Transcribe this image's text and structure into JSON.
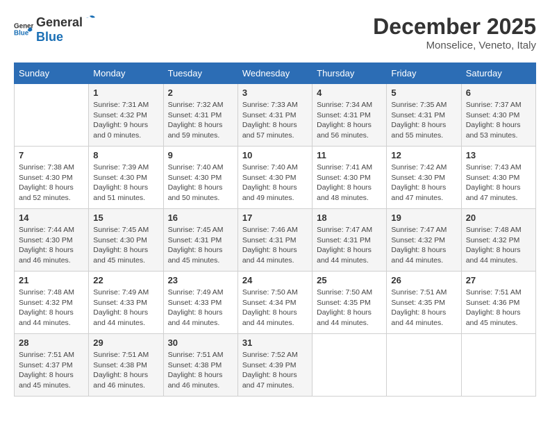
{
  "header": {
    "logo_general": "General",
    "logo_blue": "Blue",
    "month": "December 2025",
    "location": "Monselice, Veneto, Italy"
  },
  "weekdays": [
    "Sunday",
    "Monday",
    "Tuesday",
    "Wednesday",
    "Thursday",
    "Friday",
    "Saturday"
  ],
  "rows": [
    [
      {
        "day": "",
        "sunrise": "",
        "sunset": "",
        "daylight": ""
      },
      {
        "day": "1",
        "sunrise": "7:31 AM",
        "sunset": "4:32 PM",
        "daylight": "9 hours and 0 minutes."
      },
      {
        "day": "2",
        "sunrise": "7:32 AM",
        "sunset": "4:31 PM",
        "daylight": "8 hours and 59 minutes."
      },
      {
        "day": "3",
        "sunrise": "7:33 AM",
        "sunset": "4:31 PM",
        "daylight": "8 hours and 57 minutes."
      },
      {
        "day": "4",
        "sunrise": "7:34 AM",
        "sunset": "4:31 PM",
        "daylight": "8 hours and 56 minutes."
      },
      {
        "day": "5",
        "sunrise": "7:35 AM",
        "sunset": "4:31 PM",
        "daylight": "8 hours and 55 minutes."
      },
      {
        "day": "6",
        "sunrise": "7:37 AM",
        "sunset": "4:30 PM",
        "daylight": "8 hours and 53 minutes."
      }
    ],
    [
      {
        "day": "7",
        "sunrise": "7:38 AM",
        "sunset": "4:30 PM",
        "daylight": "8 hours and 52 minutes."
      },
      {
        "day": "8",
        "sunrise": "7:39 AM",
        "sunset": "4:30 PM",
        "daylight": "8 hours and 51 minutes."
      },
      {
        "day": "9",
        "sunrise": "7:40 AM",
        "sunset": "4:30 PM",
        "daylight": "8 hours and 50 minutes."
      },
      {
        "day": "10",
        "sunrise": "7:40 AM",
        "sunset": "4:30 PM",
        "daylight": "8 hours and 49 minutes."
      },
      {
        "day": "11",
        "sunrise": "7:41 AM",
        "sunset": "4:30 PM",
        "daylight": "8 hours and 48 minutes."
      },
      {
        "day": "12",
        "sunrise": "7:42 AM",
        "sunset": "4:30 PM",
        "daylight": "8 hours and 47 minutes."
      },
      {
        "day": "13",
        "sunrise": "7:43 AM",
        "sunset": "4:30 PM",
        "daylight": "8 hours and 47 minutes."
      }
    ],
    [
      {
        "day": "14",
        "sunrise": "7:44 AM",
        "sunset": "4:30 PM",
        "daylight": "8 hours and 46 minutes."
      },
      {
        "day": "15",
        "sunrise": "7:45 AM",
        "sunset": "4:30 PM",
        "daylight": "8 hours and 45 minutes."
      },
      {
        "day": "16",
        "sunrise": "7:45 AM",
        "sunset": "4:31 PM",
        "daylight": "8 hours and 45 minutes."
      },
      {
        "day": "17",
        "sunrise": "7:46 AM",
        "sunset": "4:31 PM",
        "daylight": "8 hours and 44 minutes."
      },
      {
        "day": "18",
        "sunrise": "7:47 AM",
        "sunset": "4:31 PM",
        "daylight": "8 hours and 44 minutes."
      },
      {
        "day": "19",
        "sunrise": "7:47 AM",
        "sunset": "4:32 PM",
        "daylight": "8 hours and 44 minutes."
      },
      {
        "day": "20",
        "sunrise": "7:48 AM",
        "sunset": "4:32 PM",
        "daylight": "8 hours and 44 minutes."
      }
    ],
    [
      {
        "day": "21",
        "sunrise": "7:48 AM",
        "sunset": "4:32 PM",
        "daylight": "8 hours and 44 minutes."
      },
      {
        "day": "22",
        "sunrise": "7:49 AM",
        "sunset": "4:33 PM",
        "daylight": "8 hours and 44 minutes."
      },
      {
        "day": "23",
        "sunrise": "7:49 AM",
        "sunset": "4:33 PM",
        "daylight": "8 hours and 44 minutes."
      },
      {
        "day": "24",
        "sunrise": "7:50 AM",
        "sunset": "4:34 PM",
        "daylight": "8 hours and 44 minutes."
      },
      {
        "day": "25",
        "sunrise": "7:50 AM",
        "sunset": "4:35 PM",
        "daylight": "8 hours and 44 minutes."
      },
      {
        "day": "26",
        "sunrise": "7:51 AM",
        "sunset": "4:35 PM",
        "daylight": "8 hours and 44 minutes."
      },
      {
        "day": "27",
        "sunrise": "7:51 AM",
        "sunset": "4:36 PM",
        "daylight": "8 hours and 45 minutes."
      }
    ],
    [
      {
        "day": "28",
        "sunrise": "7:51 AM",
        "sunset": "4:37 PM",
        "daylight": "8 hours and 45 minutes."
      },
      {
        "day": "29",
        "sunrise": "7:51 AM",
        "sunset": "4:38 PM",
        "daylight": "8 hours and 46 minutes."
      },
      {
        "day": "30",
        "sunrise": "7:51 AM",
        "sunset": "4:38 PM",
        "daylight": "8 hours and 46 minutes."
      },
      {
        "day": "31",
        "sunrise": "7:52 AM",
        "sunset": "4:39 PM",
        "daylight": "8 hours and 47 minutes."
      },
      {
        "day": "",
        "sunrise": "",
        "sunset": "",
        "daylight": ""
      },
      {
        "day": "",
        "sunrise": "",
        "sunset": "",
        "daylight": ""
      },
      {
        "day": "",
        "sunrise": "",
        "sunset": "",
        "daylight": ""
      }
    ]
  ],
  "labels": {
    "sunrise_prefix": "Sunrise: ",
    "sunset_prefix": "Sunset: ",
    "daylight_prefix": "Daylight: "
  }
}
